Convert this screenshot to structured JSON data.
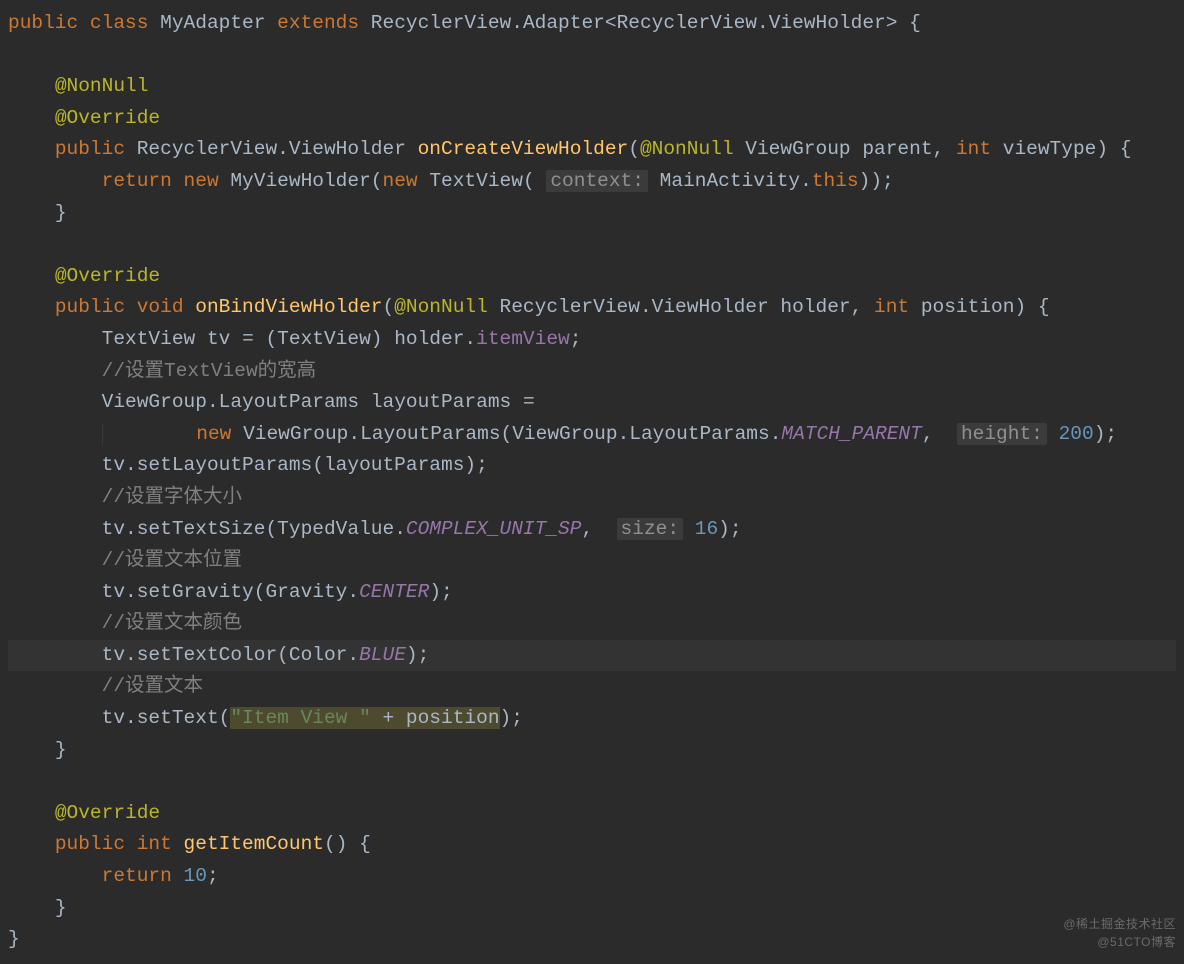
{
  "watermark": {
    "line1": "@稀土掘金技术社区",
    "line2": "@51CTO博客"
  },
  "code": {
    "kw": {
      "public": "public",
      "class": "class",
      "extends": "extends",
      "return": "return",
      "new": "new",
      "void": "void",
      "int": "int",
      "this": "this"
    },
    "cls": {
      "MyAdapter": "MyAdapter",
      "RecyclerView": "RecyclerView",
      "Adapter": "Adapter",
      "ViewHolder": "ViewHolder",
      "ViewGroup": "ViewGroup",
      "MyViewHolder": "MyViewHolder",
      "TextView": "TextView",
      "MainActivity": "MainActivity",
      "LayoutParams": "LayoutParams",
      "TypedValue": "TypedValue",
      "Gravity": "Gravity",
      "Color": "Color"
    },
    "ann": {
      "NonNull": "@NonNull",
      "Override": "@Override"
    },
    "meth": {
      "onCreateViewHolder": "onCreateViewHolder",
      "onBindViewHolder": "onBindViewHolder",
      "getItemCount": "getItemCount"
    },
    "param": {
      "parent": "parent",
      "viewType": "viewType",
      "holder": "holder",
      "position": "position"
    },
    "var": {
      "tv": "tv",
      "layoutParams": "layoutParams"
    },
    "field": {
      "itemView": "itemView"
    },
    "const": {
      "MATCH_PARENT": "MATCH_PARENT",
      "COMPLEX_UNIT_SP": "COMPLEX_UNIT_SP",
      "CENTER": "CENTER",
      "BLUE": "BLUE"
    },
    "call": {
      "setLayoutParams": "setLayoutParams",
      "setTextSize": "setTextSize",
      "setGravity": "setGravity",
      "setTextColor": "setTextColor",
      "setText": "setText"
    },
    "hint": {
      "context": "context:",
      "height": "height:",
      "size": "size:"
    },
    "num": {
      "n200": "200",
      "n16": "16",
      "n10": "10"
    },
    "str": {
      "itemView": "\"Item View \""
    },
    "cmt": {
      "wh": "//设置TextView的宽高",
      "fs": "//设置字体大小",
      "tp": "//设置文本位置",
      "tc": "//设置文本颜色",
      "tx": "//设置文本"
    },
    "punct": {
      "lt": "<",
      "gt": ">",
      "dot": ".",
      "lb": "{",
      "rb": "}",
      "lp": "(",
      "rp": ")",
      "semi": ";",
      "comma": ",",
      "eq": "=",
      "plus": "+"
    }
  }
}
